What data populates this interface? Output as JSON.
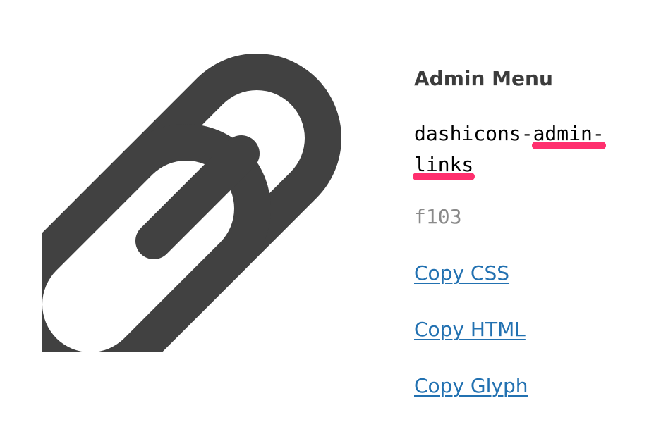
{
  "category": "Admin Menu",
  "icon": {
    "name_part1": "dashicons-",
    "name_part2": "admin-",
    "name_part3": "links",
    "code": "f103",
    "icon_name": "admin-links-icon",
    "fill_color": "#414141"
  },
  "highlight_color": "#ff2f6e",
  "links": {
    "copy_css": "Copy CSS",
    "copy_html": "Copy HTML",
    "copy_glyph": "Copy Glyph"
  }
}
